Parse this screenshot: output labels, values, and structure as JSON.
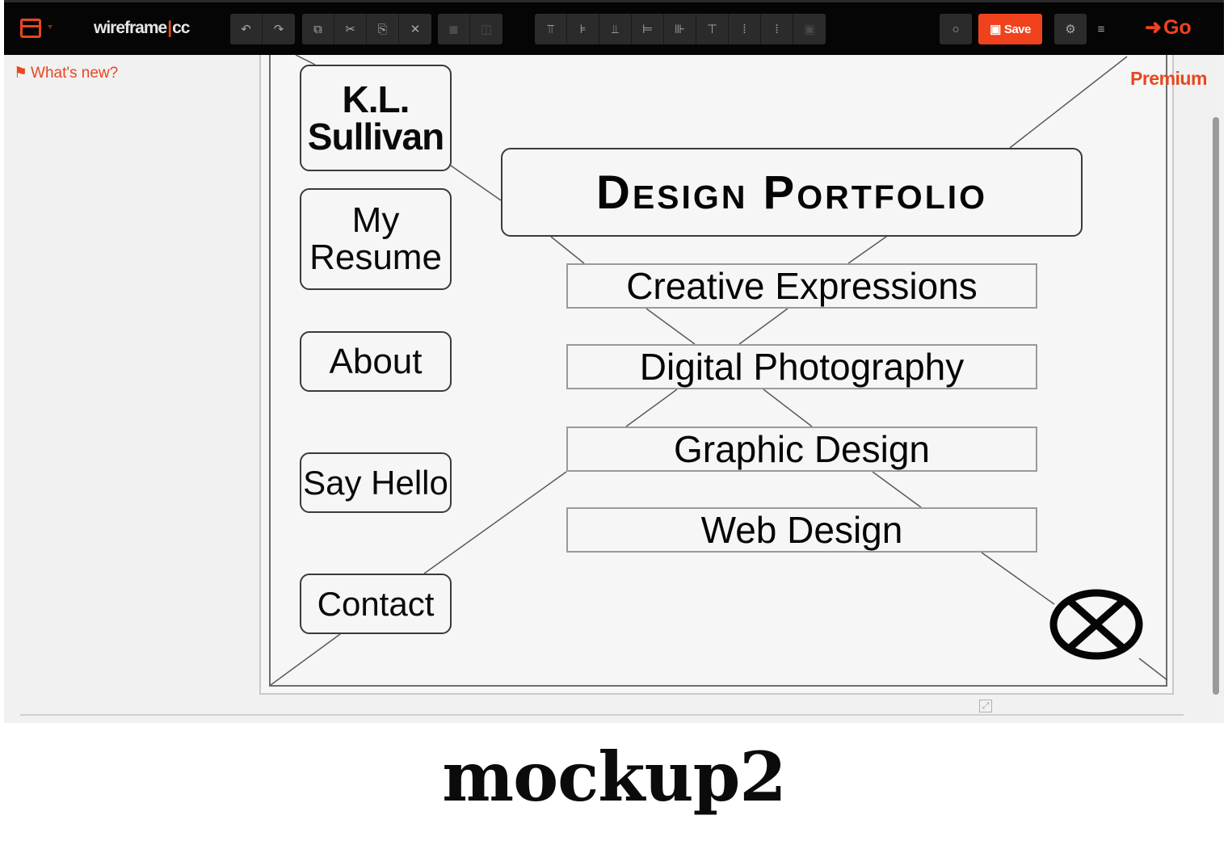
{
  "app": {
    "brand_left": "wireframe",
    "brand_sep": "|",
    "brand_right": "cc",
    "accent_color": "#f0421d"
  },
  "toolbar": {
    "history": [
      {
        "name": "undo-icon",
        "glyph": "↶"
      },
      {
        "name": "redo-icon",
        "glyph": "↷"
      }
    ],
    "edit": [
      {
        "name": "copy-icon",
        "glyph": "⧉"
      },
      {
        "name": "cut-icon",
        "glyph": "✂"
      },
      {
        "name": "paste-icon",
        "glyph": "⎘"
      },
      {
        "name": "delete-icon",
        "glyph": "✕"
      }
    ],
    "layers": [
      {
        "name": "bring-front-icon",
        "glyph": "◼"
      },
      {
        "name": "send-back-icon",
        "glyph": "◫"
      }
    ],
    "align": [
      {
        "name": "align-top-icon",
        "glyph": "⫪"
      },
      {
        "name": "align-left-icon",
        "glyph": "⊧"
      },
      {
        "name": "align-bottom-icon",
        "glyph": "⫫"
      },
      {
        "name": "align-right-icon",
        "glyph": "⊨"
      },
      {
        "name": "align-center-h-icon",
        "glyph": "⊪"
      },
      {
        "name": "align-center-v-icon",
        "glyph": "⊤"
      },
      {
        "name": "distribute-v-icon",
        "glyph": "⁞"
      },
      {
        "name": "distribute-h-icon",
        "glyph": "⦙"
      },
      {
        "name": "group-icon",
        "glyph": "▣"
      }
    ],
    "comment_glyph": "○",
    "save_label": "Save",
    "settings_glyph": "⚙",
    "menu_glyph": "≡",
    "go_label": "Go"
  },
  "left_panel": {
    "whats_new": "What's new?"
  },
  "premium_label": "Premium",
  "wireframe": {
    "nav": {
      "brand": "K.L. Sullivan",
      "resume": "My Resume",
      "about": "About",
      "say_hello": "Say Hello",
      "contact": "Contact"
    },
    "title": "Design Portfolio",
    "categories": [
      "Creative Expressions",
      "Digital Photography",
      "Graphic Design",
      "Web Design"
    ]
  },
  "caption": "mockup2"
}
